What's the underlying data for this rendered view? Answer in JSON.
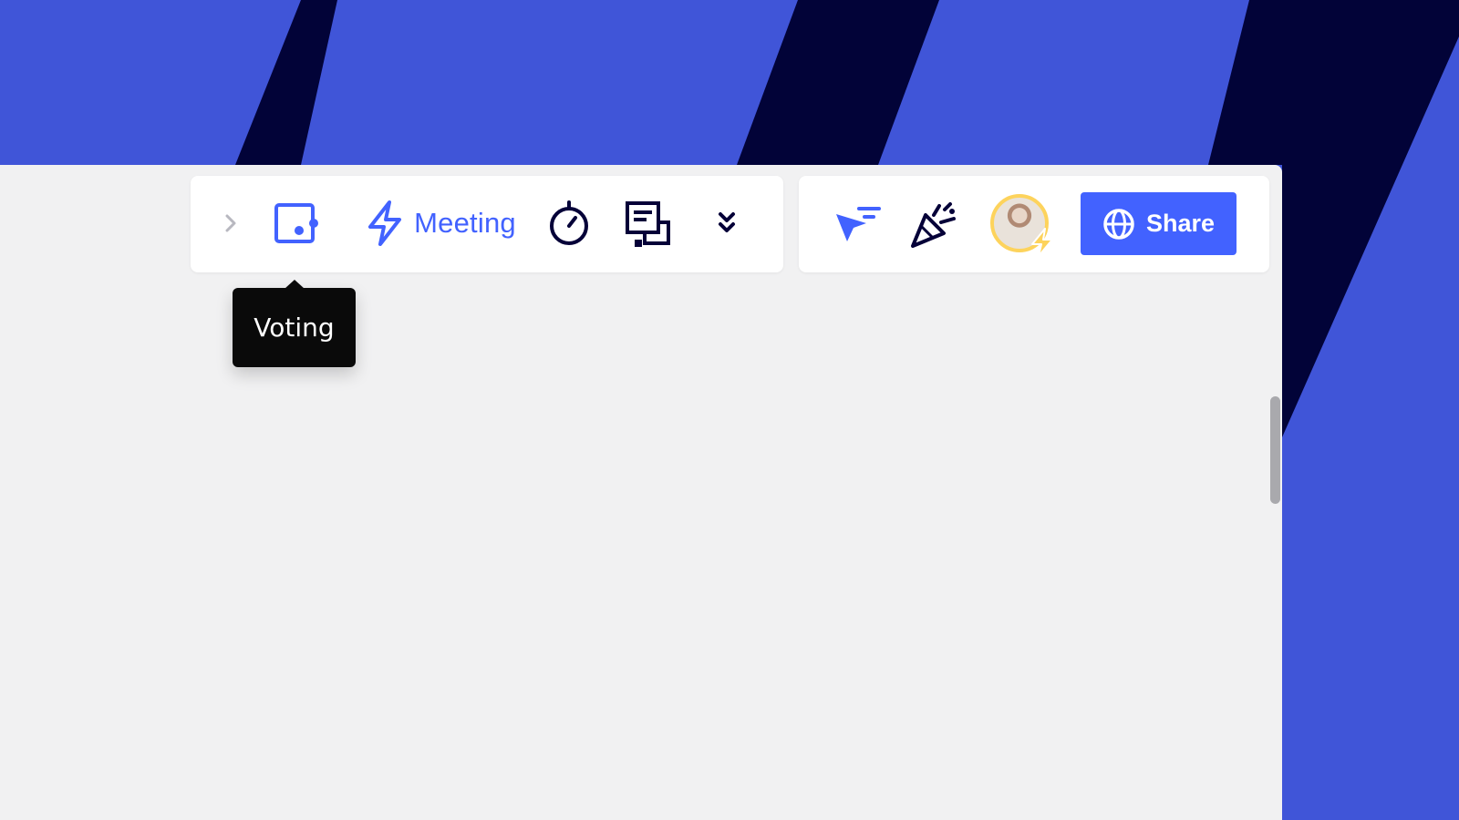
{
  "colors": {
    "background_blue": "#4055d8",
    "background_navy": "#020338",
    "board": "#f1f1f2",
    "accent_blue": "#4262ff",
    "icon_dark": "#050038",
    "tooltip_bg": "#0a0a0a",
    "avatar_ring": "#fdd35c"
  },
  "toolbar_left": {
    "expand_icon": "chevron-right-icon",
    "voting_icon": "voting-icon",
    "meeting_icon": "lightning-icon",
    "meeting_label": "Meeting",
    "timer_icon": "stopwatch-icon",
    "notes_icon": "notes-icon",
    "more_icon": "double-chevron-down-icon"
  },
  "toolbar_right": {
    "cursor_icon": "cursor-filter-icon",
    "reactions_icon": "party-popper-icon",
    "avatar_badge_icon": "lightning-icon",
    "share_icon": "globe-icon",
    "share_label": "Share"
  },
  "tooltip": {
    "text": "Voting"
  }
}
